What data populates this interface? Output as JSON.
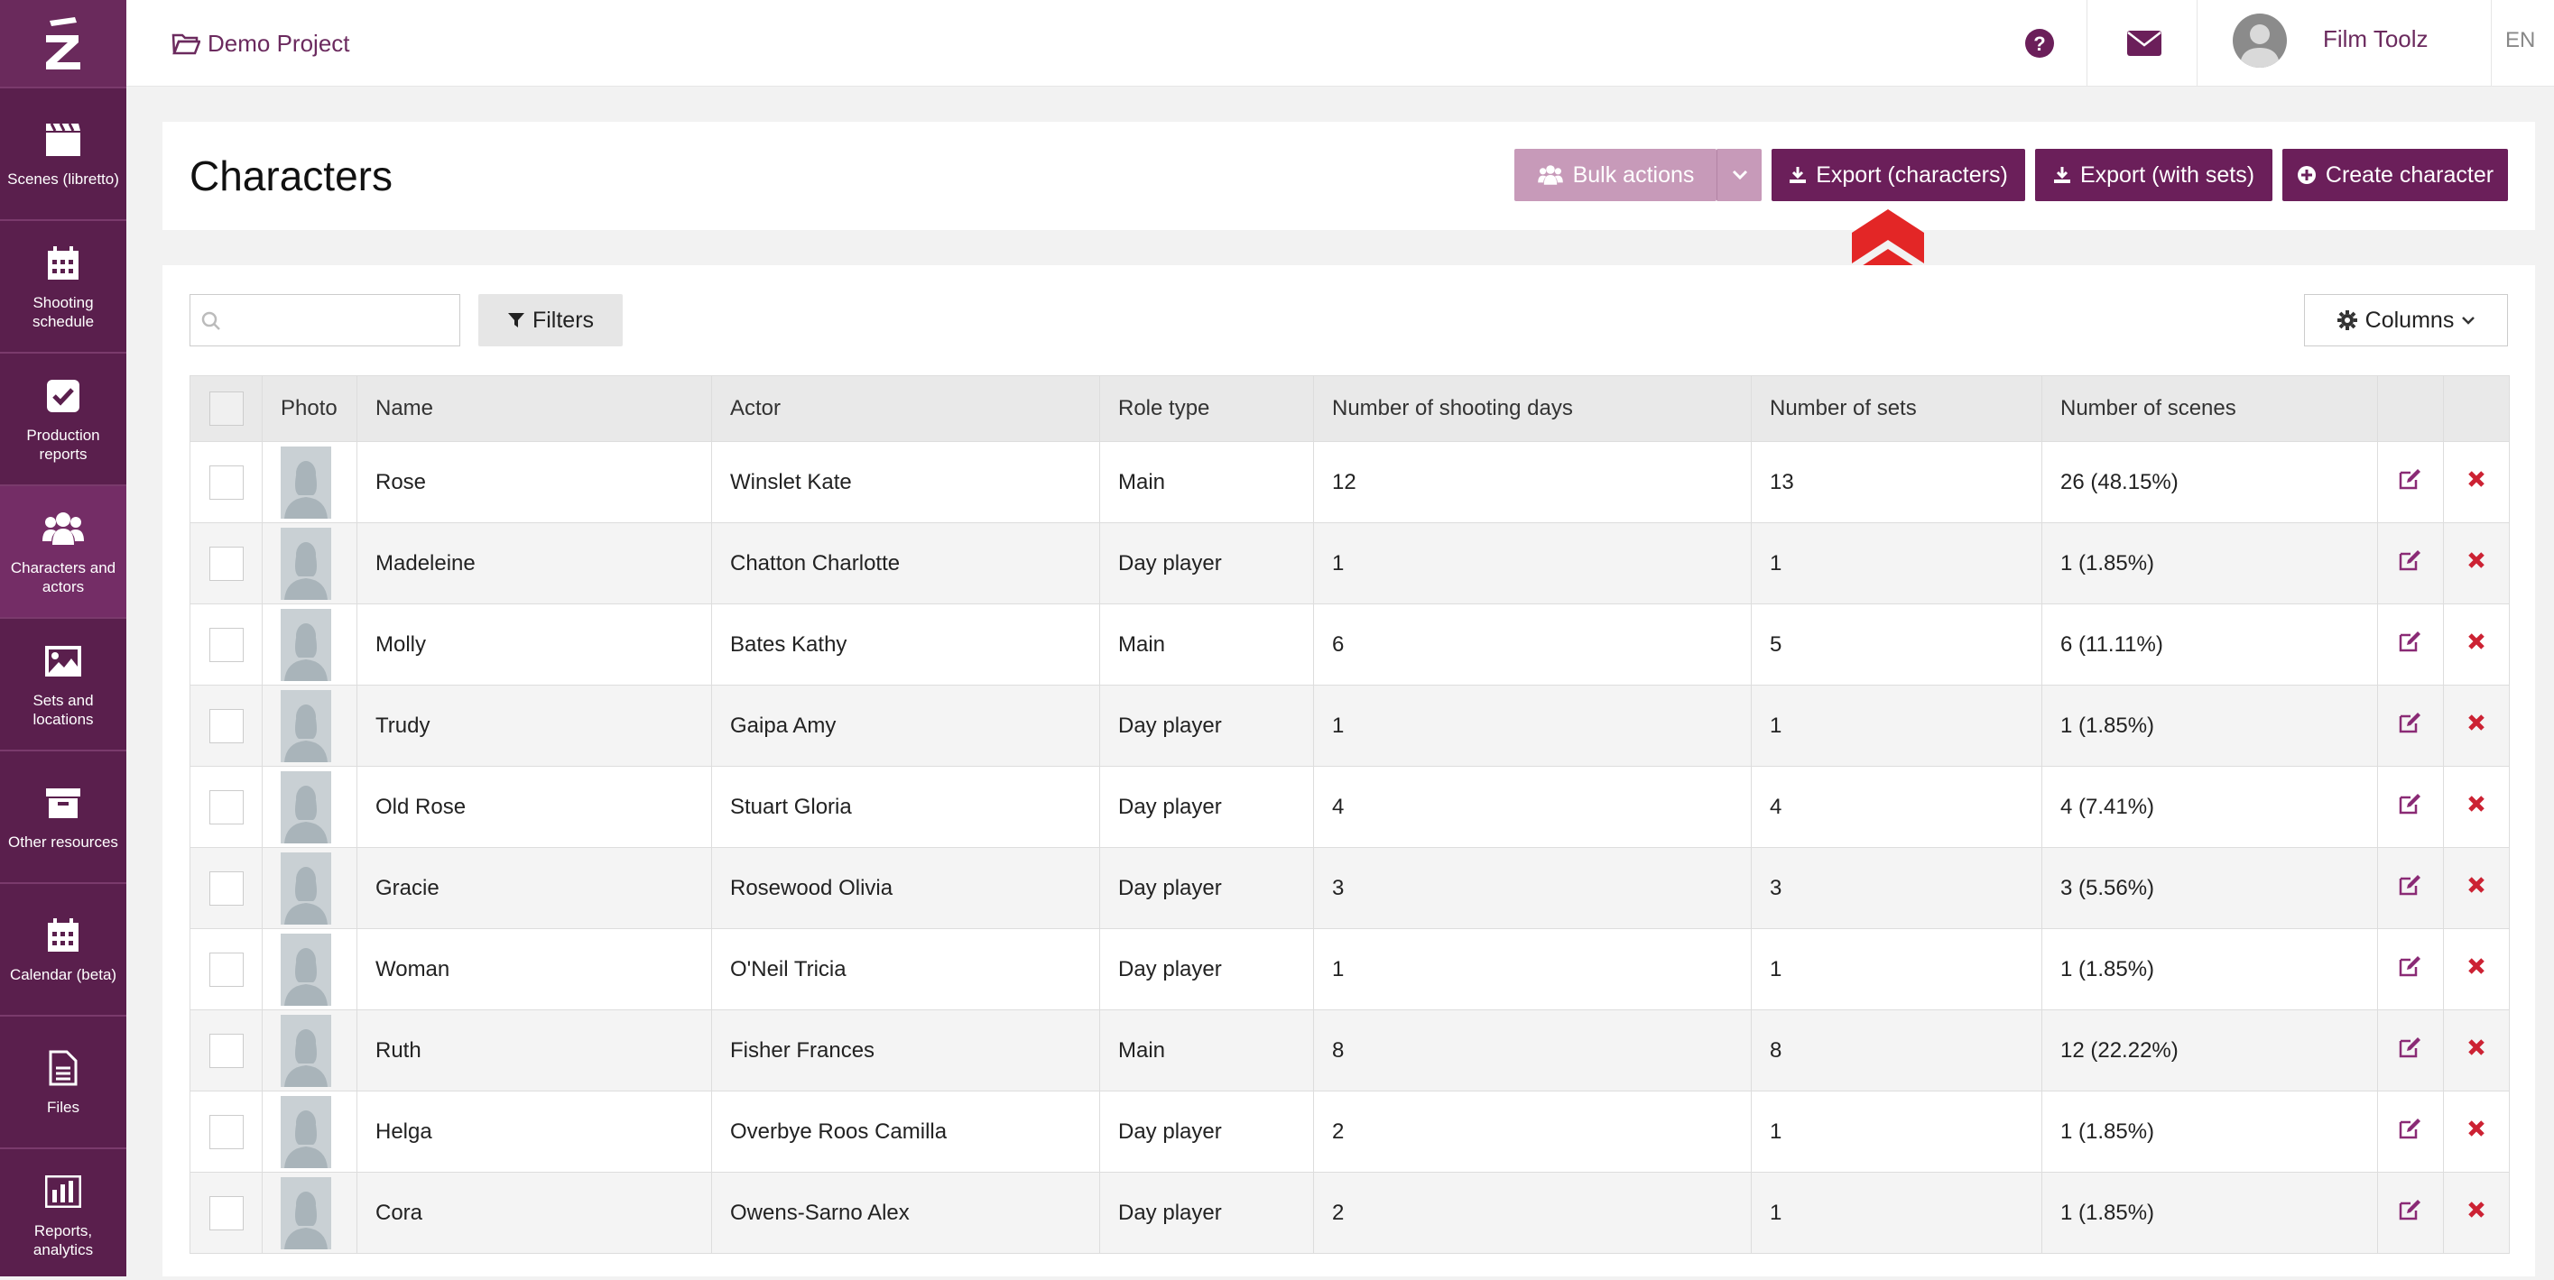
{
  "app": {
    "logo_icon": "film-toolz-logo",
    "project_name": "Demo Project",
    "user_name": "Film Toolz",
    "language": "EN"
  },
  "sidebar": {
    "items": [
      {
        "label": "Scenes (libretto)",
        "icon": "clapperboard-icon"
      },
      {
        "label": "Shooting schedule",
        "icon": "calendar-icon"
      },
      {
        "label": "Production reports",
        "icon": "check-square-icon"
      },
      {
        "label": "Characters and actors",
        "icon": "users-icon",
        "active": true
      },
      {
        "label": "Sets and locations",
        "icon": "image-icon"
      },
      {
        "label": "Other resources",
        "icon": "archive-icon"
      },
      {
        "label": "Calendar (beta)",
        "icon": "calendar-icon"
      },
      {
        "label": "Files",
        "icon": "file-icon"
      },
      {
        "label": "Reports, analytics",
        "icon": "bar-chart-icon"
      }
    ]
  },
  "header": {
    "title": "Characters",
    "bulk_actions": "Bulk actions",
    "export_characters": "Export (characters)",
    "export_with_sets": "Export (with sets)",
    "create_character": "Create character"
  },
  "toolbar": {
    "search_placeholder": "",
    "filters_label": "Filters",
    "columns_label": "Columns"
  },
  "table": {
    "columns": [
      "Photo",
      "Name",
      "Actor",
      "Role type",
      "Number of shooting days",
      "Number of sets",
      "Number of scenes"
    ],
    "rows": [
      {
        "name": "Rose",
        "actor": "Winslet Kate",
        "role": "Main",
        "days": "12",
        "sets": "13",
        "scenes": "26 (48.15%)"
      },
      {
        "name": "Madeleine",
        "actor": "Chatton Charlotte",
        "role": "Day player",
        "days": "1",
        "sets": "1",
        "scenes": "1 (1.85%)"
      },
      {
        "name": "Molly",
        "actor": "Bates Kathy",
        "role": "Main",
        "days": "6",
        "sets": "5",
        "scenes": "6 (11.11%)"
      },
      {
        "name": "Trudy",
        "actor": "Gaipa Amy",
        "role": "Day player",
        "days": "1",
        "sets": "1",
        "scenes": "1 (1.85%)"
      },
      {
        "name": "Old Rose",
        "actor": "Stuart Gloria",
        "role": "Day player",
        "days": "4",
        "sets": "4",
        "scenes": "4 (7.41%)"
      },
      {
        "name": "Gracie",
        "actor": "Rosewood Olivia",
        "role": "Day player",
        "days": "3",
        "sets": "3",
        "scenes": "3 (5.56%)"
      },
      {
        "name": "Woman",
        "actor": "O'Neil Tricia",
        "role": "Day player",
        "days": "1",
        "sets": "1",
        "scenes": "1 (1.85%)"
      },
      {
        "name": "Ruth",
        "actor": "Fisher Frances",
        "role": "Main",
        "days": "8",
        "sets": "8",
        "scenes": "12 (22.22%)"
      },
      {
        "name": "Helga",
        "actor": "Overbye Roos Camilla",
        "role": "Day player",
        "days": "2",
        "sets": "1",
        "scenes": "1 (1.85%)"
      },
      {
        "name": "Cora",
        "actor": "Owens-Sarno Alex",
        "role": "Day player",
        "days": "2",
        "sets": "1",
        "scenes": "1 (1.85%)"
      }
    ]
  },
  "colors": {
    "sidebar": "#5a1f4d",
    "primary": "#6b1f5a",
    "muted_button": "#c79ab9",
    "delete": "#cc2233",
    "annotation_arrow": "#e32626"
  }
}
